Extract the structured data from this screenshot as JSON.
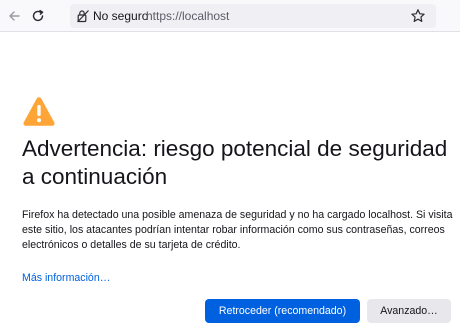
{
  "toolbar": {
    "back_icon": "back-arrow-icon",
    "reload_icon": "reload-icon",
    "security_label": "No seguro",
    "security_icon": "lock-warning-icon",
    "url": "https://localhost",
    "bookmark_icon": "star-icon"
  },
  "warning": {
    "icon": "warning-triangle-icon",
    "icon_color": "#ffa436",
    "title": "Advertencia: riesgo potencial de seguridad a continuación",
    "description": "Firefox ha detectado una posible amenaza de seguridad y no ha cargado localhost. Si visita este sitio, los atacantes podrían intentar robar información como sus contraseñas, correos electrónicos o detalles de su tarjeta de crédito.",
    "more_info_link": "Más información…"
  },
  "actions": {
    "primary_label": "Retroceder (recomendado)",
    "secondary_label": "Avanzado…"
  },
  "colors": {
    "accent": "#0061e0",
    "secondary_button": "#e8e8ec"
  }
}
